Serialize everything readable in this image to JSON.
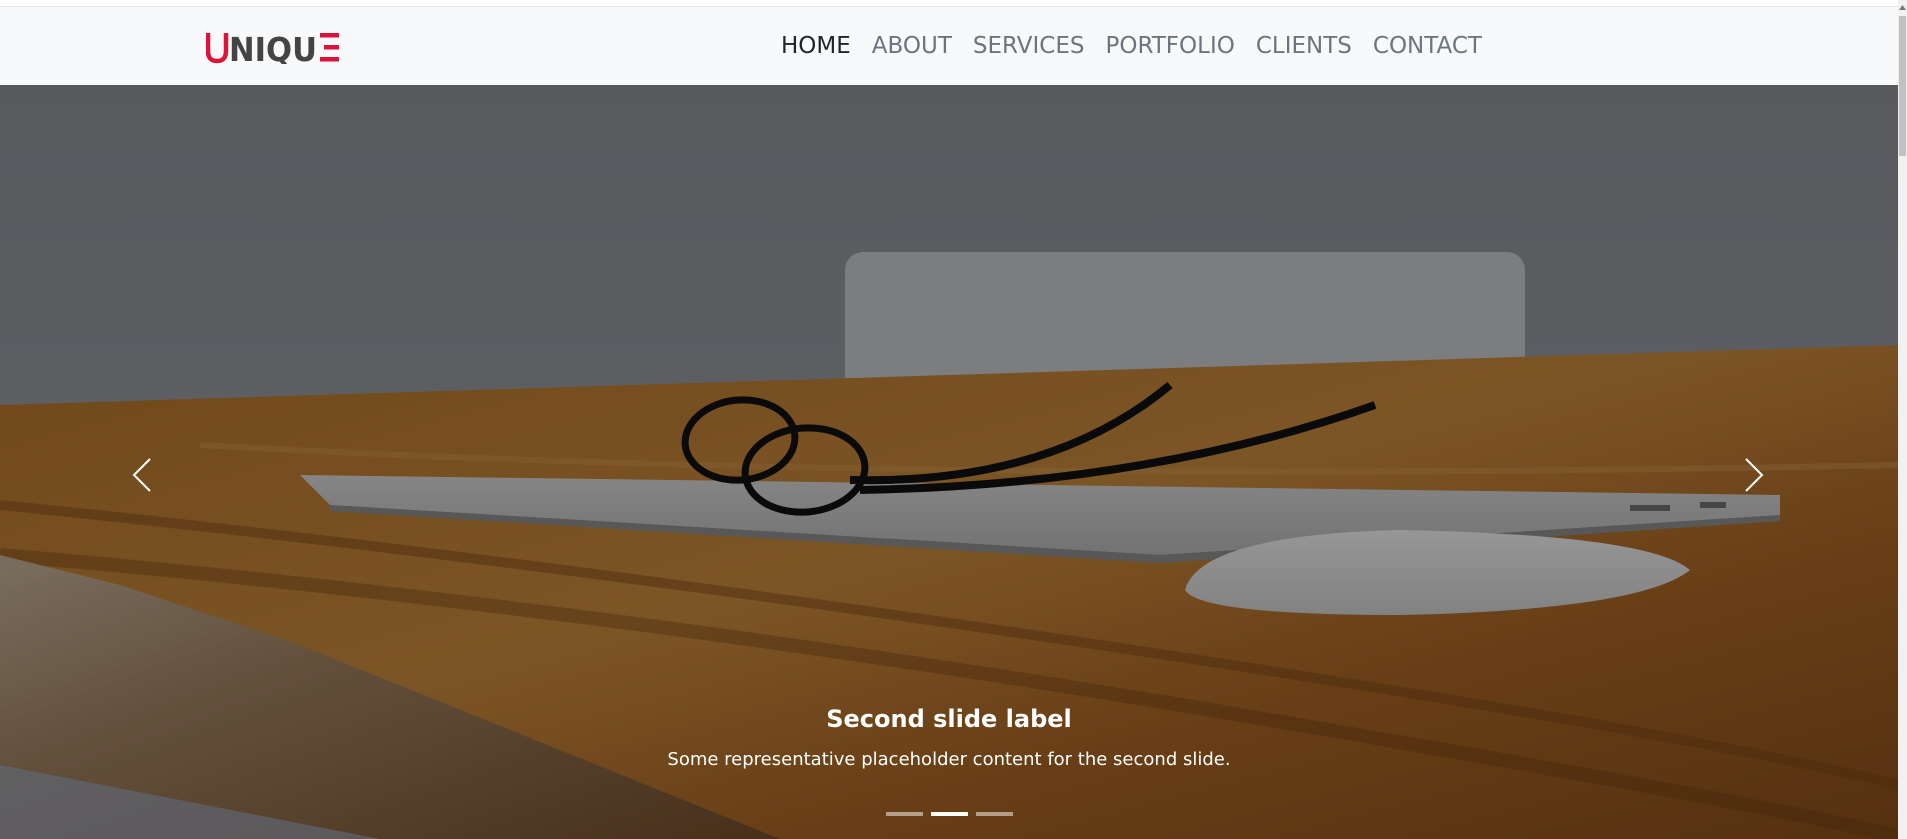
{
  "brand": {
    "letters": [
      "U",
      "NIQU",
      "E"
    ],
    "accent_color": "#dc143c",
    "dark_color": "#444444"
  },
  "nav": {
    "items": [
      {
        "label": "HOME",
        "active": true
      },
      {
        "label": "ABOUT",
        "active": false
      },
      {
        "label": "SERVICES",
        "active": false
      },
      {
        "label": "PORTFOLIO",
        "active": false
      },
      {
        "label": "CLIENTS",
        "active": false
      },
      {
        "label": "CONTACT",
        "active": false
      }
    ]
  },
  "carousel": {
    "caption_title": "Second slide label",
    "caption_text": "Some representative placeholder content for the second slide.",
    "slide_count": 3,
    "active_index": 1,
    "prev_icon": "chevron-left-icon",
    "next_icon": "chevron-right-icon",
    "background_image": "desk-with-glasses-laptop-mouse"
  }
}
